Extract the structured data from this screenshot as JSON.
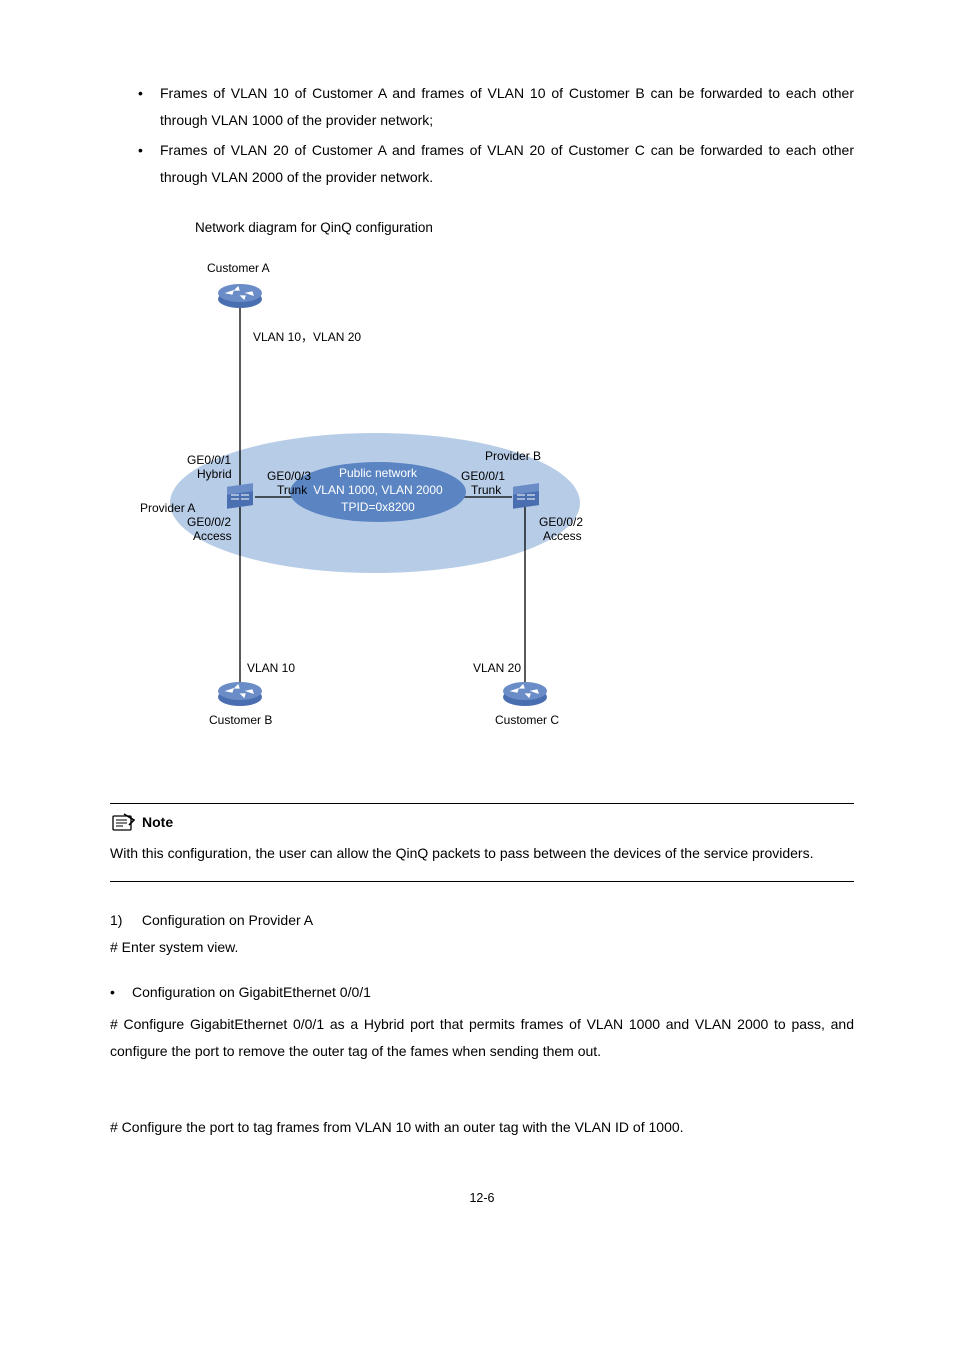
{
  "bullets": [
    "Frames of VLAN 10 of Customer A and frames of VLAN 10 of Customer B can be forwarded to each other through VLAN 1000 of the provider network;",
    "Frames of VLAN 20 of Customer A and frames of VLAN 20 of Customer C can be forwarded to each other through VLAN 2000 of the provider network."
  ],
  "figure_title": "Network diagram for QinQ configuration",
  "diagram": {
    "customer_a": "Customer A",
    "customer_b": "Customer B",
    "customer_c": "Customer C",
    "vlan_a": "VLAN 10，VLAN 20",
    "vlan_b": "VLAN 10",
    "vlan_c": "VLAN 20",
    "provider_a": "Provider A",
    "provider_b": "Provider B",
    "ge001_hybrid_a": "GE0/0/1",
    "ge001_hybrid_b": "Hybrid",
    "ge003_trunk_a": "GE0/0/3",
    "ge003_trunk_b": "Trunk",
    "ge002_access_a": "GE0/0/2",
    "ge002_access_b": "Access",
    "b_ge001_trunk_a": "GE0/0/1",
    "b_ge001_trunk_b": "Trunk",
    "b_ge002_access_a": "GE0/0/2",
    "b_ge002_access_b": "Access",
    "public_net_a": "Public network",
    "public_net_b": "VLAN 1000, VLAN 2000",
    "public_net_c": "TPID=0x8200"
  },
  "note": {
    "label": "Note",
    "text": "With this configuration, the user can allow the QinQ packets to pass between the devices of the service providers."
  },
  "step1_num": "1)",
  "step1": "Configuration on Provider A",
  "step1_cmd": "# Enter system view.",
  "sub_bullet": "Configuration on GigabitEthernet 0/0/1",
  "sub_text": "# Configure GigabitEthernet 0/0/1 as a Hybrid port that permits frames of VLAN 1000 and VLAN 2000 to pass, and configure the port to remove the outer tag of the fames when sending them out.",
  "last_text": "# Configure the port to tag frames from VLAN 10 with an outer tag with the VLAN ID of 1000.",
  "page_num": "12-6"
}
